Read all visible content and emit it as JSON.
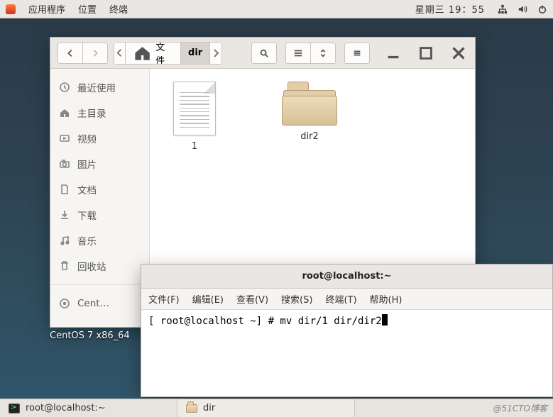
{
  "topbar": {
    "menu1": "应用程序",
    "menu2": "位置",
    "menu3": "终端",
    "clock": "星期三 19：55"
  },
  "fm": {
    "path": {
      "home": "主文件夹",
      "dir": "dir"
    },
    "sidebar": {
      "recent": "最近使用",
      "home": "主目录",
      "videos": "视频",
      "pictures": "图片",
      "documents": "文档",
      "downloads": "下载",
      "music": "音乐",
      "trash": "回收站",
      "cent": "Cent…"
    },
    "files": {
      "f1": "1",
      "f2": "dir2"
    }
  },
  "term": {
    "title": "root@localhost:~",
    "menus": {
      "file": "文件(F)",
      "edit": "编辑(E)",
      "view": "查看(V)",
      "search": "搜索(S)",
      "terminal": "终端(T)",
      "help": "帮助(H)"
    },
    "line": "[ root@localhost ~] # mv dir/1 dir/dir2"
  },
  "desktop": {
    "label": "CentOS 7 x86_64"
  },
  "taskbar": {
    "task1": "root@localhost:~",
    "task2": "dir",
    "watermark": "@51CTO博客"
  }
}
